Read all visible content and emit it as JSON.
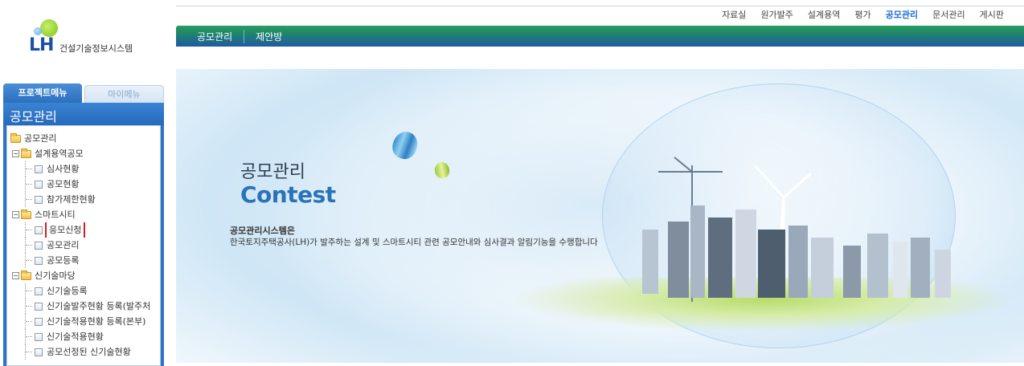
{
  "logo": {
    "brand": "LH",
    "system_name": "건설기술정보시스템"
  },
  "top_menu": [
    {
      "label": "자료실",
      "active": false
    },
    {
      "label": "원가발주",
      "active": false
    },
    {
      "label": "설계용역",
      "active": false
    },
    {
      "label": "평가",
      "active": false
    },
    {
      "label": "공모관리",
      "active": true
    },
    {
      "label": "문서관리",
      "active": false
    },
    {
      "label": "게시판",
      "active": false
    }
  ],
  "sub_menu": {
    "item1": "공모관리",
    "item2": "제안방"
  },
  "panel": {
    "tab_project": "프로젝트메뉴",
    "tab_my": "마이메뉴",
    "title": "공모관리"
  },
  "tree": {
    "root": "공모관리",
    "g1": {
      "label": "설계용역공모",
      "c1": "심사현황",
      "c2": "공모현황",
      "c3": "참가제한현황"
    },
    "g2": {
      "label": "스마트시티",
      "c1": "응모신청",
      "c2": "공모관리",
      "c3": "공모등록"
    },
    "g3": {
      "label": "신기술마당",
      "c1": "신기술등록",
      "c2": "신기술발주현황 등록(발주처",
      "c3": "신기술적용현황 등록(본부)",
      "c4": "신기술적용현황",
      "c5": "공모선정된 신기술현황"
    }
  },
  "hero": {
    "title_ko": "공모관리",
    "title_en": "Contest",
    "desc_title": "공모관리시스템은",
    "desc": "한국토지주택공사(LH)가 발주하는 설계 및 스마트시티 관련 공모안내와 심사결과 알림기능을 수행합니다"
  },
  "colors": {
    "accent": "#1a6fd0",
    "brand_blue": "#1e4fa6",
    "highlight": "#d11f1f"
  }
}
